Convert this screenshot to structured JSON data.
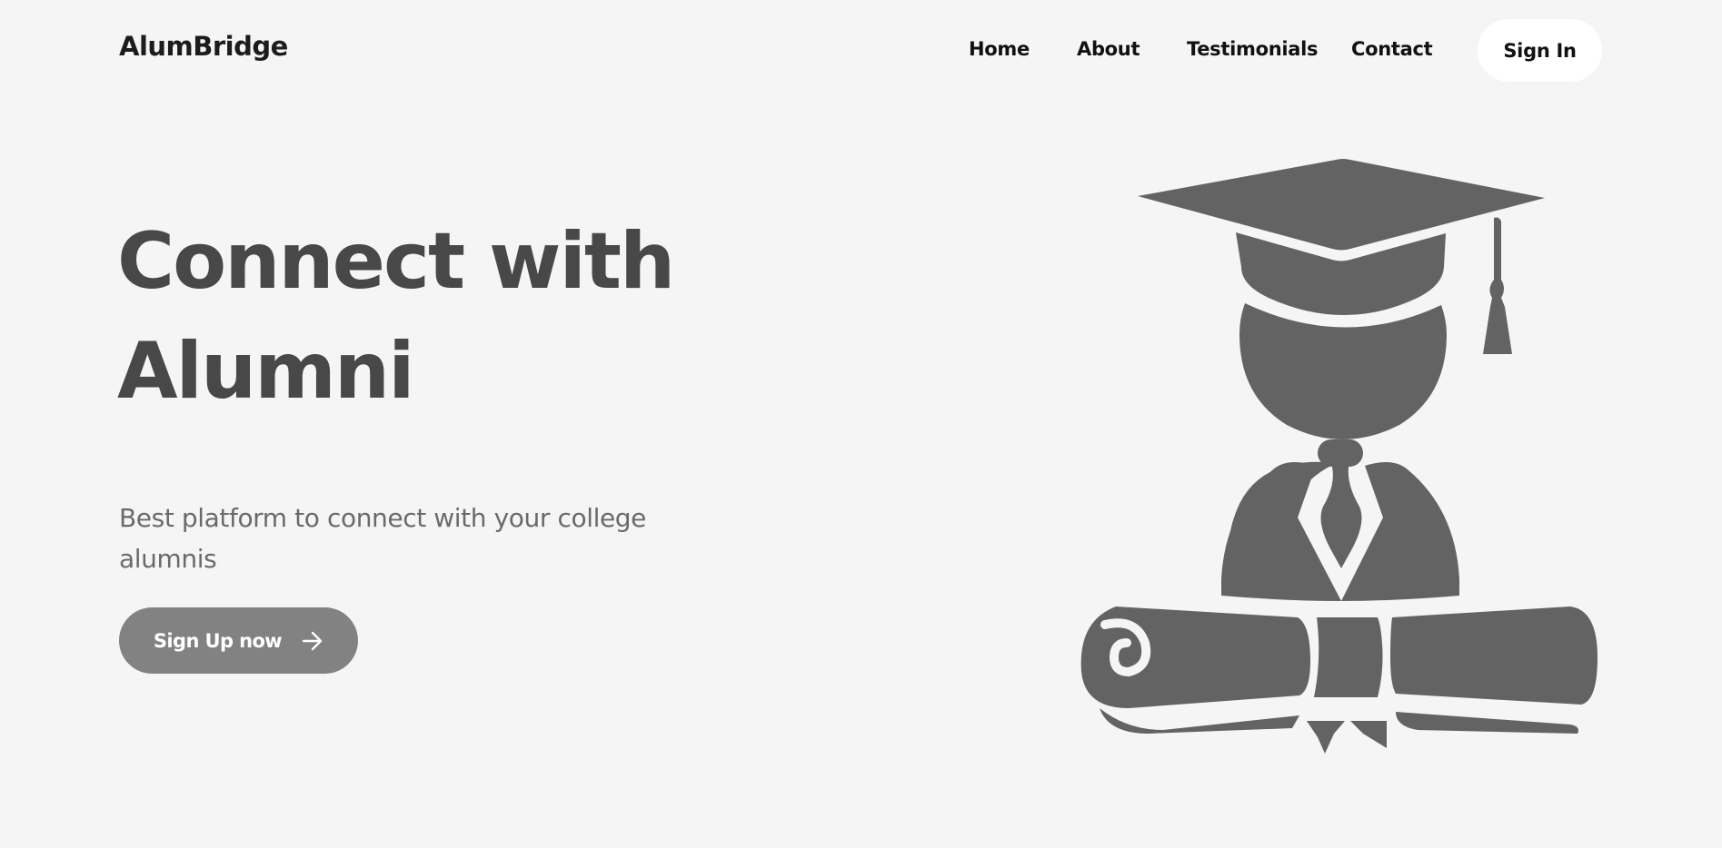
{
  "brand": {
    "name": "AlumBridge"
  },
  "nav": {
    "items": [
      "Home",
      "About",
      "Testimonials",
      "Contact"
    ],
    "signin_label": "Sign In"
  },
  "hero": {
    "title_line1": "Connect with",
    "title_line2": "Alumni",
    "subtitle_line1": "Best platform to connect with your college",
    "subtitle_line2": "alumnis",
    "cta_label": "Sign Up now",
    "cta_icon": "arrow-right-icon",
    "illustration": "graduate-with-diploma-illustration"
  },
  "colors": {
    "background": "#f5f5f5",
    "title": "#484848",
    "subtitle": "#6a6a6a",
    "cta_background": "#828282",
    "illustration": "#636363",
    "signin_background": "#ffffff"
  }
}
